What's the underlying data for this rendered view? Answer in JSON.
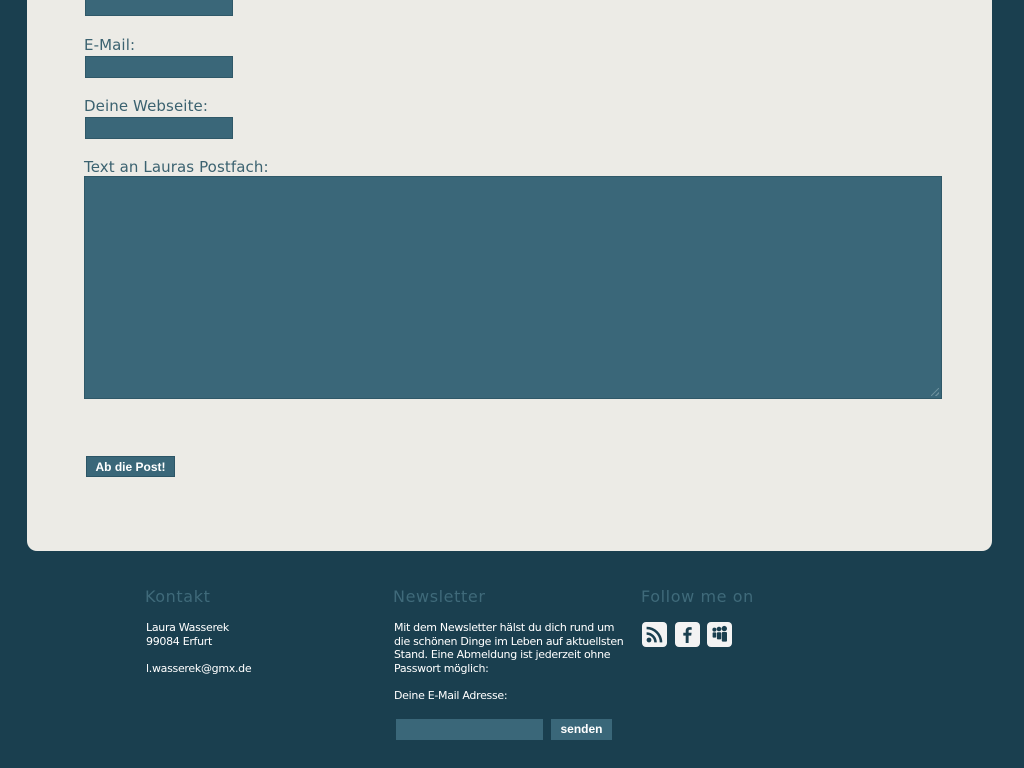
{
  "form": {
    "email_label": "E-Mail:",
    "website_label": "Deine Webseite:",
    "message_label": "Text an Lauras Postfach:",
    "submit_label": "Ab die Post!"
  },
  "footer": {
    "contact": {
      "heading": "Kontakt",
      "name": "Laura Wasserek",
      "city": "99084 Erfurt",
      "email": "l.wasserek@gmx.de"
    },
    "newsletter": {
      "heading": "Newsletter",
      "description": "Mit dem Newsletter hälst du dich rund um die schönen Dinge im Leben auf aktuellsten Stand. Eine Abmeldung ist jederzeit ohne Passwort möglich:",
      "email_label": "Deine E-Mail Adresse:",
      "send_label": "senden"
    },
    "follow": {
      "heading": "Follow me on",
      "icons": [
        "rss-icon",
        "facebook-icon",
        "myspace-icon"
      ]
    }
  },
  "colors": {
    "page_background": "#1a3f4f",
    "panel_background": "#ecebe6",
    "input_fill": "#3a6779",
    "label_text": "#3b6270"
  }
}
